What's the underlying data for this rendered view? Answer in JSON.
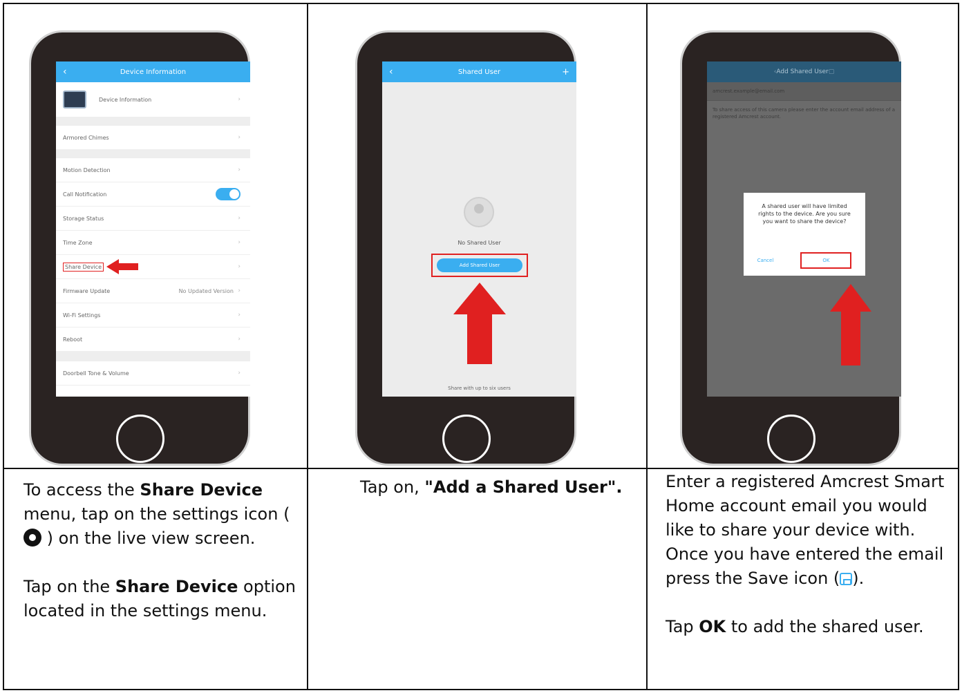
{
  "phone1": {
    "title": "Device Information",
    "rows": [
      {
        "label": "Device Information"
      },
      {
        "label": "Armored Chimes"
      },
      {
        "label": "Motion Detection"
      },
      {
        "label": "Call Notification"
      },
      {
        "label": "Storage Status"
      },
      {
        "label": "Time Zone"
      },
      {
        "label": "Share Device"
      },
      {
        "label": "Firmware Update",
        "value": "No Updated Version"
      },
      {
        "label": "Wi-Fi Settings"
      },
      {
        "label": "Reboot"
      },
      {
        "label": "Doorbell Tone & Volume"
      }
    ]
  },
  "phone2": {
    "title": "Shared User",
    "empty_text": "No Shared User",
    "button": "Add Shared User",
    "footnote": "Share with up to six users"
  },
  "phone3": {
    "title": "Add Shared User",
    "email": "amcrest.example@email.com",
    "note": "To share access of this camera please enter the account email address of a registered Amcrest account.",
    "dialog_message": "A shared user will have limited rights to the device. Are you sure you want to share the device?",
    "cancel": "Cancel",
    "ok": "OK"
  },
  "col1": {
    "p1_a": "To access the ",
    "p1_b": "Share Device",
    "p1_c": " menu, tap on the settings icon (",
    "p1_d": ") on the live view screen.",
    "p2_a": "Tap on the ",
    "p2_b": "Share Device",
    "p2_c": " option located in the settings menu."
  },
  "col2": {
    "a": "Tap on, ",
    "b": "\"Add a Shared User\"."
  },
  "col3": {
    "p1_a": "Enter a registered Amcrest Smart Home account email you would like to share your device with. Once you have entered the email press the Save icon (",
    "p1_b": ").",
    "p2_a": "Tap ",
    "p2_b": "OK",
    "p2_c": " to add the shared user."
  },
  "colors": {
    "accent": "#3aaef0",
    "highlight": "#e02020",
    "phone_body": "#2a2322"
  }
}
